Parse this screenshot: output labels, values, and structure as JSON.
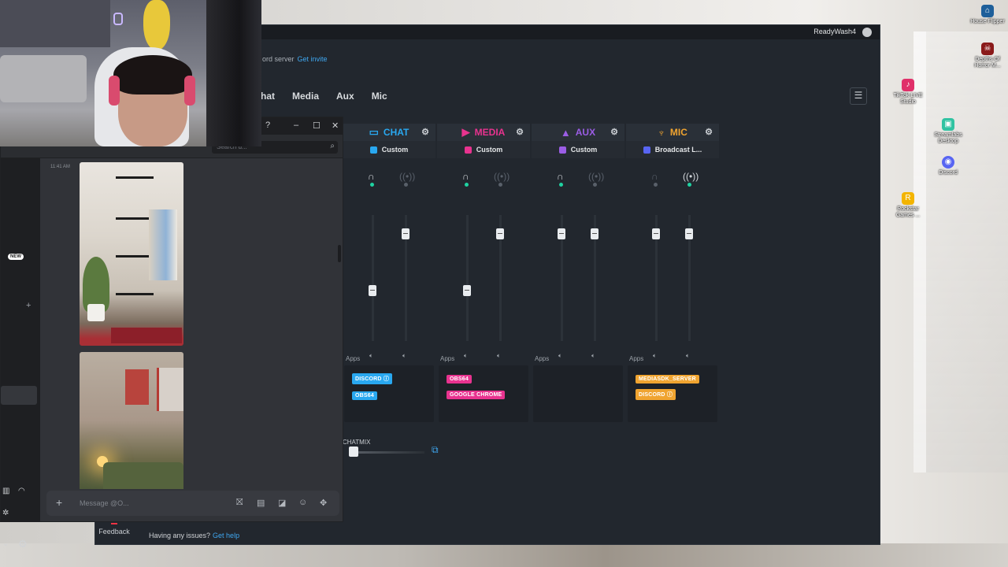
{
  "desktop": {
    "icons": [
      {
        "label": "House Flipper",
        "color": "#1e5f9a"
      },
      {
        "label": "Depths Of Horror M...",
        "color": "#8a1a1a"
      },
      {
        "label": "TikTok LIVE Studio",
        "color": "#e0306a"
      },
      {
        "label": "Streamlabs Desktop",
        "color": "#31c3a2"
      },
      {
        "label": "Discord",
        "color": "#5865f2"
      },
      {
        "label": "Rockstar Games ...",
        "color": "#f3b400"
      }
    ]
  },
  "app": {
    "username": "ReadyWash4",
    "notice_text": "ord server",
    "notice_link": "Get invite",
    "tabs": [
      "hat",
      "Media",
      "Aux",
      "Mic"
    ],
    "menu_icon": "☰",
    "channels": [
      {
        "name": "CHAT",
        "color": "#29a8f0",
        "icon": "▭",
        "preset": "Custom",
        "preset_color": "#29a8f0",
        "apps": [
          {
            "label": "DISCORD ⓘ",
            "color": "#29a8f0"
          },
          {
            "label": "OBS64",
            "color": "#29a8f0"
          }
        ],
        "headphone_level": 0.4,
        "stream_level": 0.85
      },
      {
        "name": "MEDIA",
        "color": "#e8338f",
        "icon": "▶",
        "preset": "Custom",
        "preset_color": "#e8338f",
        "apps": [
          {
            "label": "OBS64",
            "color": "#e8338f"
          },
          {
            "label": "GOOGLE CHROME",
            "color": "#e8338f"
          }
        ],
        "headphone_level": 0.4,
        "stream_level": 0.85
      },
      {
        "name": "AUX",
        "color": "#9b5de5",
        "icon": "▲",
        "preset": "Custom",
        "preset_color": "#9b5de5",
        "apps": [],
        "headphone_level": 0.85,
        "stream_level": 0.85
      },
      {
        "name": "MIC",
        "color": "#f0a430",
        "icon": "♆",
        "preset": "Broadcast L...",
        "preset_color": "#5865f2",
        "apps": [
          {
            "label": "MEDIASDK_SERVER",
            "color": "#f0a430"
          },
          {
            "label": "DISCORD ⓘ",
            "color": "#f0a430"
          }
        ],
        "headphone_level": 0.85,
        "stream_level": 0.85
      }
    ],
    "apps_label": "Apps",
    "chatmix_label": "CHATMIX",
    "feedback_label": "Feedback",
    "help_text": "Having any issues?",
    "help_link": "Get help"
  },
  "discord": {
    "search_placeholder": "Search d...",
    "timestamp": "11:41 AM",
    "new_badge": "NEW",
    "message_placeholder": "Message @O...",
    "window_buttons": [
      "?",
      "–",
      "☐",
      "✕"
    ]
  }
}
